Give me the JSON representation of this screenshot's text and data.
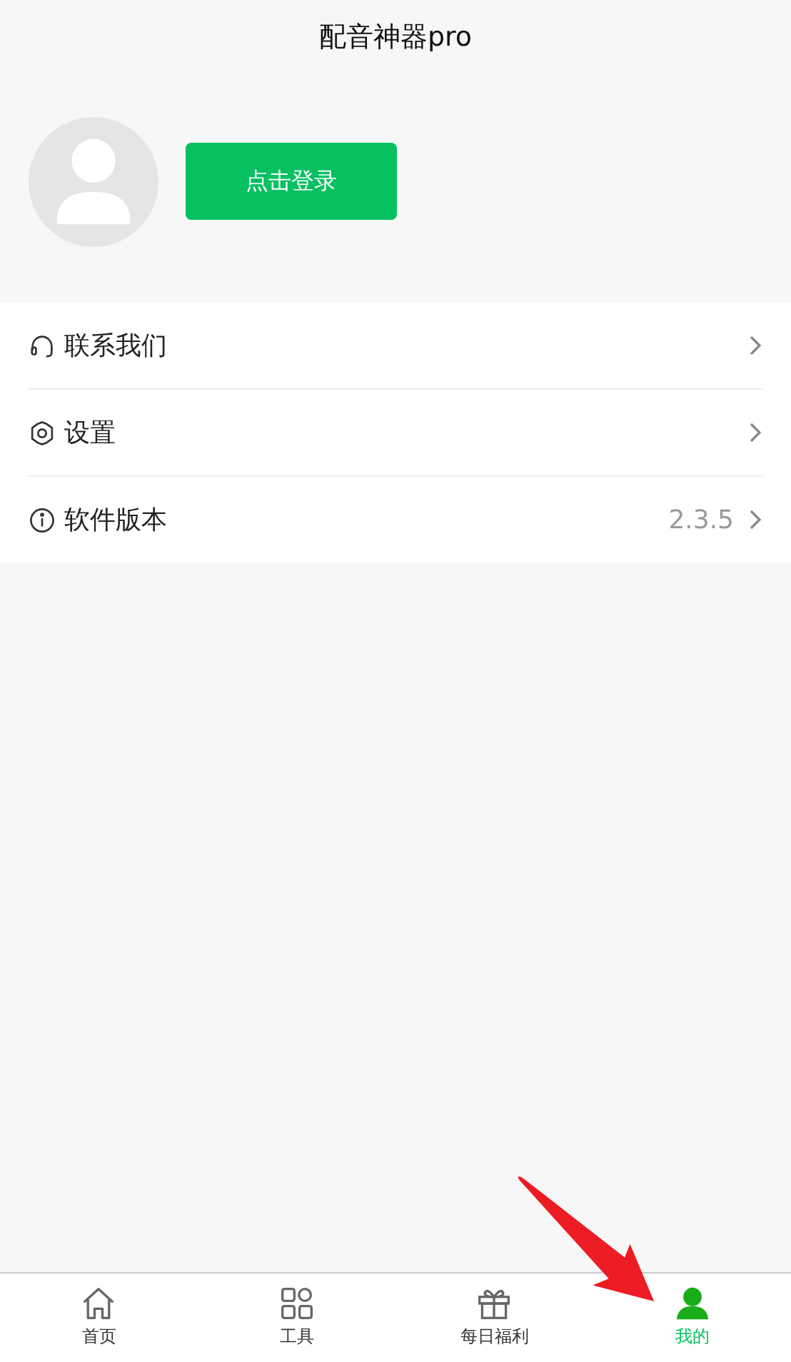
{
  "title": "配音神器pro",
  "profile": {
    "login_button": "点击登录"
  },
  "menu": [
    {
      "kind": "headset",
      "label": "联系我们"
    },
    {
      "kind": "gear",
      "label": "设置"
    },
    {
      "kind": "info",
      "label": "软件版本",
      "value": "2.3.5"
    }
  ],
  "tabs": [
    {
      "kind": "home",
      "label": "首页",
      "selected": false
    },
    {
      "kind": "grid",
      "label": "工具",
      "selected": false
    },
    {
      "kind": "gift",
      "label": "每日福利",
      "selected": false
    },
    {
      "kind": "person",
      "label": "我的",
      "selected": true
    }
  ]
}
